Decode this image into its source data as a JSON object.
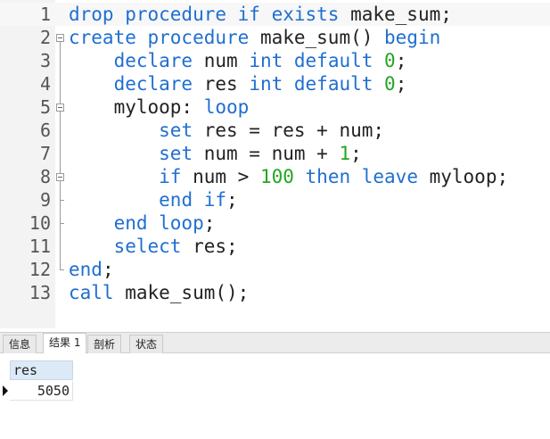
{
  "editor": {
    "lines": [
      {
        "n": "1",
        "tokens": [
          [
            "kw",
            "drop procedure if exists"
          ],
          [
            "",
            "make_sum;"
          ]
        ]
      },
      {
        "n": "2",
        "tokens": [
          [
            "kw",
            "create procedure"
          ],
          [
            "",
            "make_sum()"
          ],
          [
            "kw",
            "begin"
          ]
        ]
      },
      {
        "n": "3",
        "tokens": [
          [
            "",
            "    "
          ],
          [
            "kw",
            "declare"
          ],
          [
            "",
            "num"
          ],
          [
            "kw",
            "int default"
          ],
          [
            "num",
            "0"
          ],
          [
            "",
            ";"
          ]
        ]
      },
      {
        "n": "4",
        "tokens": [
          [
            "",
            "    "
          ],
          [
            "kw",
            "declare"
          ],
          [
            "",
            "res"
          ],
          [
            "kw",
            "int default"
          ],
          [
            "num",
            "0"
          ],
          [
            "",
            ";"
          ]
        ]
      },
      {
        "n": "5",
        "tokens": [
          [
            "",
            "    myloop:"
          ],
          [
            "kw",
            "loop"
          ]
        ]
      },
      {
        "n": "6",
        "tokens": [
          [
            "",
            "        "
          ],
          [
            "kw",
            "set"
          ],
          [
            "",
            "res = res + num;"
          ]
        ]
      },
      {
        "n": "7",
        "tokens": [
          [
            "",
            "        "
          ],
          [
            "kw",
            "set"
          ],
          [
            "",
            "num = num +"
          ],
          [
            "num",
            "1"
          ],
          [
            "",
            ";"
          ]
        ]
      },
      {
        "n": "8",
        "tokens": [
          [
            "",
            "        "
          ],
          [
            "kw",
            "if"
          ],
          [
            "",
            "num >"
          ],
          [
            "num",
            "100"
          ],
          [
            "kw",
            "then leave"
          ],
          [
            "",
            "myloop;"
          ]
        ]
      },
      {
        "n": "9",
        "tokens": [
          [
            "",
            "        "
          ],
          [
            "kw",
            "end if"
          ],
          [
            "",
            ";"
          ]
        ]
      },
      {
        "n": "10",
        "tokens": [
          [
            "",
            "    "
          ],
          [
            "kw",
            "end loop"
          ],
          [
            "",
            ";"
          ]
        ]
      },
      {
        "n": "11",
        "tokens": [
          [
            "",
            "    "
          ],
          [
            "kw",
            "select"
          ],
          [
            "",
            "res;"
          ]
        ]
      },
      {
        "n": "12",
        "tokens": [
          [
            "kw",
            "end"
          ],
          [
            "",
            ";"
          ]
        ]
      },
      {
        "n": "13",
        "tokens": [
          [
            "kw",
            "call"
          ],
          [
            "",
            "make_sum();"
          ]
        ]
      }
    ]
  },
  "tabs": [
    {
      "label": "信息",
      "active": false
    },
    {
      "label": "结果 1",
      "active": true
    },
    {
      "label": "剖析",
      "active": false
    },
    {
      "label": "状态",
      "active": false
    }
  ],
  "results": {
    "column": "res",
    "value": "5050"
  }
}
